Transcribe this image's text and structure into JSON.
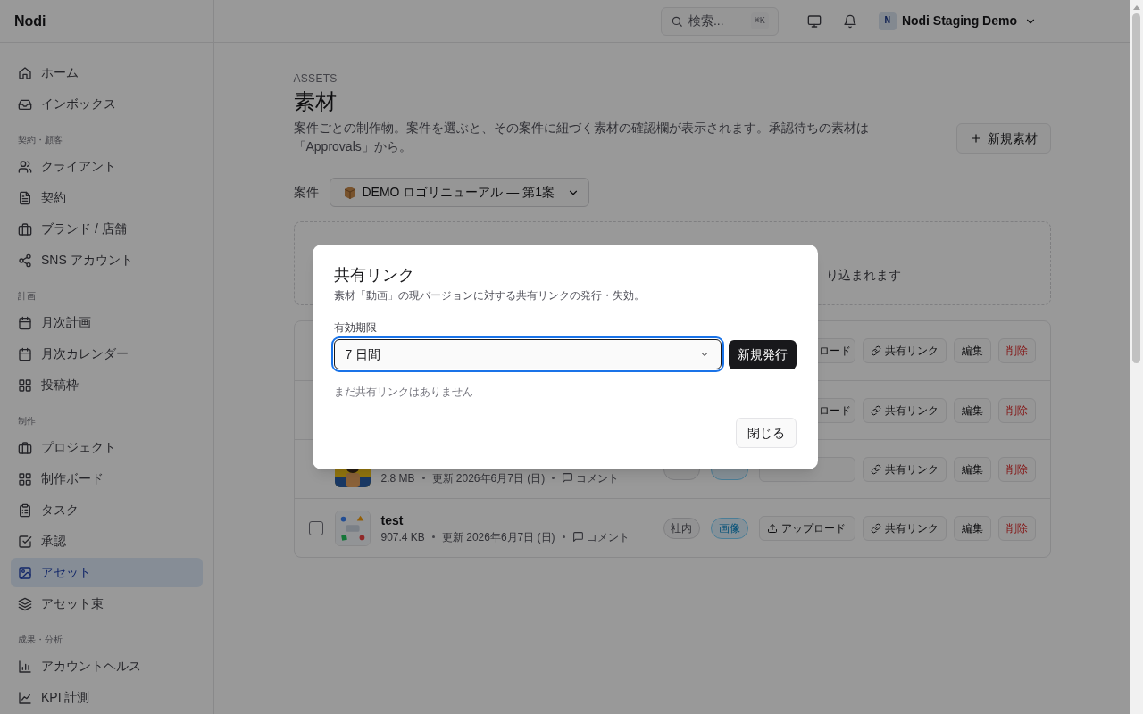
{
  "sidebar": {
    "brand": "Nodi",
    "sections": [
      {
        "items": [
          {
            "label": "ホーム",
            "selected": false
          },
          {
            "label": "インボックス",
            "selected": false
          }
        ]
      },
      {
        "heading": "契約・顧客",
        "items": [
          {
            "label": "クライアント",
            "selected": false
          },
          {
            "label": "契約",
            "selected": false
          },
          {
            "label": "ブランド / 店舗",
            "selected": false
          },
          {
            "label": "SNS アカウント",
            "selected": false
          }
        ]
      },
      {
        "heading": "計画",
        "items": [
          {
            "label": "月次計画",
            "selected": false
          },
          {
            "label": "月次カレンダー",
            "selected": false
          },
          {
            "label": "投稿枠",
            "selected": false
          }
        ]
      },
      {
        "heading": "制作",
        "items": [
          {
            "label": "プロジェクト",
            "selected": false
          },
          {
            "label": "制作ボード",
            "selected": false
          },
          {
            "label": "タスク",
            "selected": false
          },
          {
            "label": "承認",
            "selected": false
          },
          {
            "label": "アセット",
            "selected": true
          },
          {
            "label": "アセット束",
            "selected": false
          }
        ]
      },
      {
        "heading": "成果・分析",
        "items": [
          {
            "label": "アカウントヘルス",
            "selected": false
          },
          {
            "label": "KPI 計測",
            "selected": false
          }
        ]
      }
    ]
  },
  "header": {
    "search": {
      "placeholder": "検索...",
      "shortcut": "⌘K"
    },
    "workspace": {
      "initial": "N",
      "name": "Nodi Staging Demo"
    }
  },
  "page": {
    "eyebrow": "ASSETS",
    "title": "素材",
    "description": "案件ごとの制作物。案件を選ぶと、その案件に紐づく素材の確認欄が表示されます。承認待ちの素材は「Approvals」から。",
    "new_button": "新規素材",
    "project": {
      "label": "案件",
      "value": "DEMO ロゴリニューアル — 第1案"
    },
    "dropzone": {
      "text": "り込まれます"
    },
    "assets": [
      {
        "upload": "ロード",
        "share": "共有リンク",
        "edit": "編集",
        "delete": "削除"
      },
      {
        "upload": "ロード",
        "share": "共有リンク",
        "edit": "編集",
        "delete": "削除"
      },
      {
        "thumbnail": {
          "kind": "picture"
        },
        "size": "2.8 MB",
        "updated": "更新 2026年6月7日 (日)",
        "comments": "コメント",
        "tags": [
          {
            "kind": "scope"
          },
          {
            "kind": "media"
          }
        ],
        "share": "共有リンク",
        "edit": "編集",
        "delete": "削除"
      },
      {
        "checked": false,
        "thumbnail": {
          "kind": "picture"
        },
        "name": "test",
        "size": "907.4 KB",
        "updated": "更新 2026年6月7日 (日)",
        "comments": "コメント",
        "tags": [
          {
            "label": "社内",
            "kind": "scope"
          },
          {
            "label": "画像",
            "kind": "media"
          }
        ],
        "upload": "アップロード",
        "share": "共有リンク",
        "edit": "編集",
        "delete": "削除"
      }
    ]
  },
  "dialog": {
    "title": "共有リンク",
    "description": "素材「動画」の現バージョンに対する共有リンクの発行・失効。",
    "expiry_label": "有効期限",
    "expiry_value": "7 日間",
    "expiry_focused": true,
    "issue_button": "新規発行",
    "empty_text": "まだ共有リンクはありません",
    "close_button": "閉じる"
  }
}
